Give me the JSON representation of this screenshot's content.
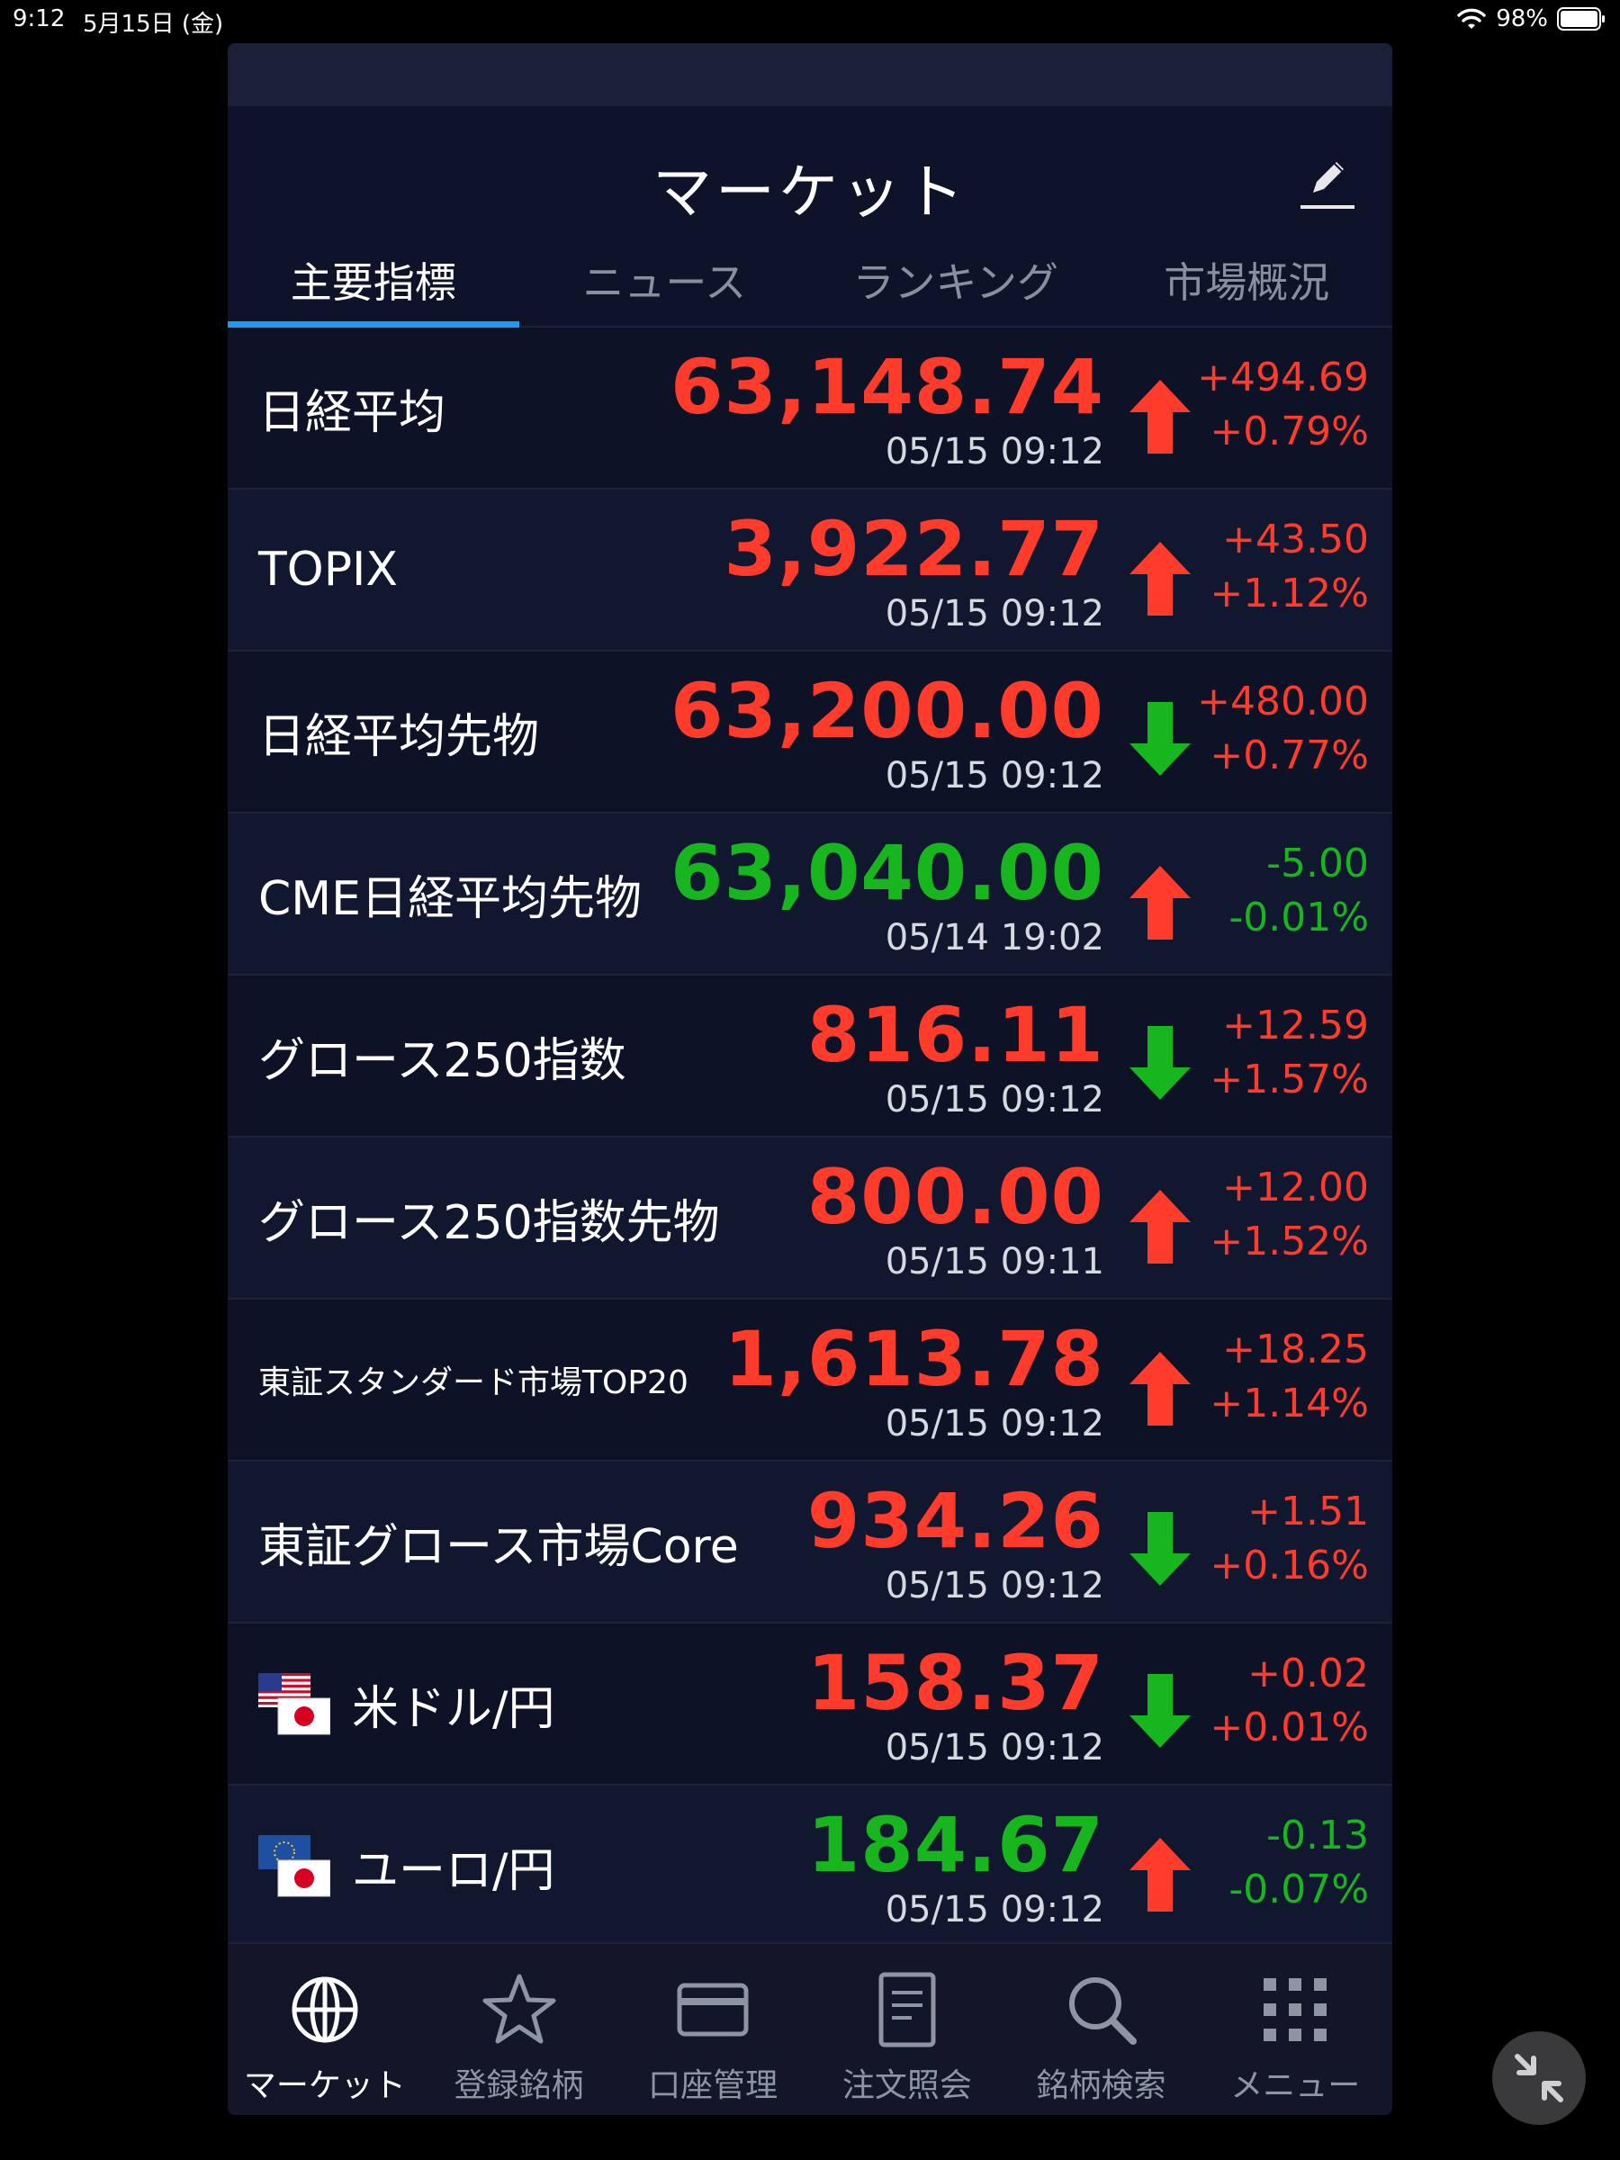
{
  "statusbar": {
    "time": "9:12",
    "date": "5月15日 (金)",
    "battery": "98%"
  },
  "header": {
    "title": "マーケット",
    "edit_icon": "pencil-icon"
  },
  "tabs": [
    {
      "label": "主要指標",
      "active": true
    },
    {
      "label": "ニュース",
      "active": false
    },
    {
      "label": "ランキング",
      "active": false
    },
    {
      "label": "市場概況",
      "active": false
    }
  ],
  "rows": [
    {
      "name": "日経平均",
      "price": "63,148.74",
      "time": "05/15 09:12",
      "arrow": "up",
      "change": "+494.69",
      "pct": "+0.79%",
      "price_dir": "up",
      "chg_dir": "up"
    },
    {
      "name": "TOPIX",
      "price": "3,922.77",
      "time": "05/15 09:12",
      "arrow": "up",
      "change": "+43.50",
      "pct": "+1.12%",
      "price_dir": "up",
      "chg_dir": "up"
    },
    {
      "name": "日経平均先物",
      "price": "63,200.00",
      "time": "05/15 09:12",
      "arrow": "down",
      "change": "+480.00",
      "pct": "+0.77%",
      "price_dir": "up",
      "chg_dir": "up"
    },
    {
      "name": "CME日経平均先物",
      "price": "63,040.00",
      "time": "05/14 19:02",
      "arrow": "up",
      "change": "-5.00",
      "pct": "-0.01%",
      "price_dir": "down",
      "chg_dir": "down"
    },
    {
      "name": "グロース250指数",
      "price": "816.11",
      "time": "05/15 09:12",
      "arrow": "down",
      "change": "+12.59",
      "pct": "+1.57%",
      "price_dir": "up",
      "chg_dir": "up"
    },
    {
      "name": "グロース250指数先物",
      "price": "800.00",
      "time": "05/15 09:11",
      "arrow": "up",
      "change": "+12.00",
      "pct": "+1.52%",
      "price_dir": "up",
      "chg_dir": "up"
    },
    {
      "name": "東証スタンダード市場TOP20",
      "price": "1,613.78",
      "time": "05/15 09:12",
      "arrow": "up",
      "change": "+18.25",
      "pct": "+1.14%",
      "price_dir": "up",
      "chg_dir": "up"
    },
    {
      "name": "東証グロース市場Core",
      "price": "934.26",
      "time": "05/15 09:12",
      "arrow": "down",
      "change": "+1.51",
      "pct": "+0.16%",
      "price_dir": "up",
      "chg_dir": "up"
    },
    {
      "name": "米ドル/円",
      "price": "158.37",
      "time": "05/15 09:12",
      "arrow": "down",
      "change": "+0.02",
      "pct": "+0.01%",
      "price_dir": "up",
      "chg_dir": "up",
      "flag": "us-jp"
    },
    {
      "name": "ユーロ/円",
      "price": "184.67",
      "time": "05/15 09:12",
      "arrow": "up",
      "change": "-0.13",
      "pct": "-0.07%",
      "price_dir": "down",
      "chg_dir": "down",
      "flag": "eu-jp"
    }
  ],
  "tabbar": [
    {
      "label": "マーケット",
      "icon": "globe-icon",
      "active": true
    },
    {
      "label": "登録銘柄",
      "icon": "star-icon",
      "active": false
    },
    {
      "label": "口座管理",
      "icon": "card-icon",
      "active": false
    },
    {
      "label": "注文照会",
      "icon": "document-icon",
      "active": false
    },
    {
      "label": "銘柄検索",
      "icon": "search-icon",
      "active": false
    },
    {
      "label": "メニュー",
      "icon": "grid-icon",
      "active": false
    }
  ],
  "colors": {
    "up": "#ff3b2b",
    "down": "#17b51e",
    "accent": "#1e9bf0",
    "bg": "#0e1226"
  }
}
